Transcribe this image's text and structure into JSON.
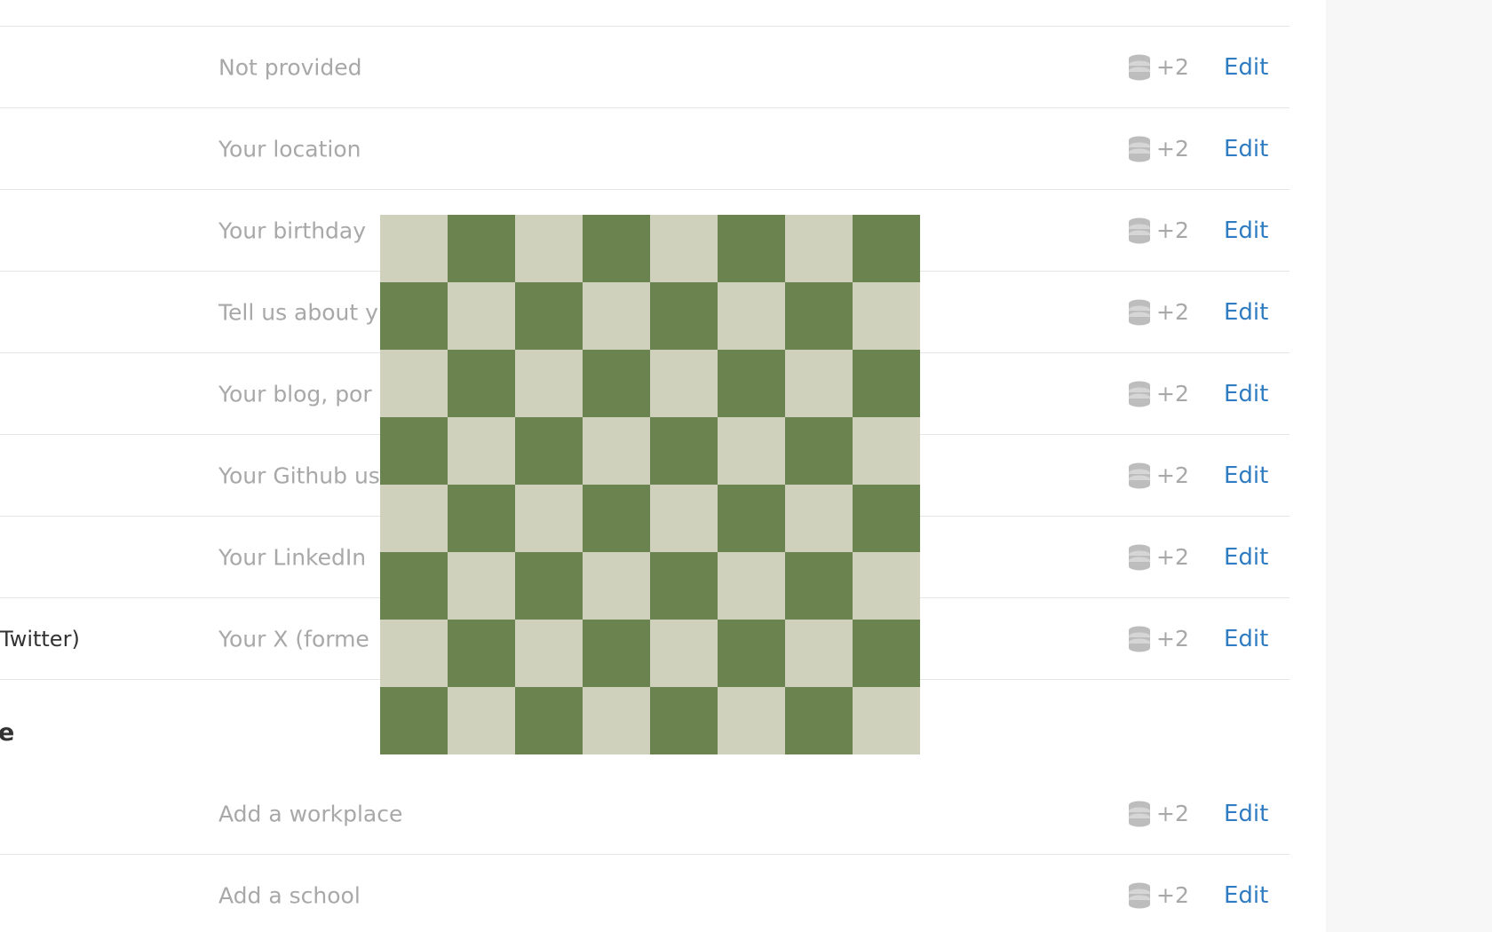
{
  "rows_top": [
    {
      "label": "",
      "value": "Not provided",
      "visibility": "+2",
      "edit": "Edit"
    },
    {
      "label": "",
      "value": "Your location",
      "visibility": "+2",
      "edit": "Edit"
    },
    {
      "label": "",
      "value": "Your birthday",
      "visibility": "+2",
      "edit": "Edit"
    },
    {
      "label": "",
      "value": "Tell us about y",
      "visibility": "+2",
      "edit": "Edit"
    },
    {
      "label": "",
      "value": "Your blog, por",
      "visibility": "+2",
      "edit": "Edit"
    },
    {
      "label": "",
      "value": "Your Github us",
      "visibility": "+2",
      "edit": "Edit"
    },
    {
      "label": "",
      "value": "Your LinkedIn",
      "visibility": "+2",
      "edit": "Edit"
    },
    {
      "label": "Twitter)",
      "value": "Your X (forme",
      "visibility": "+2",
      "edit": "Edit"
    }
  ],
  "section_heading": "e",
  "rows_bottom": [
    {
      "label": "",
      "value": "Add a workplace",
      "visibility": "+2",
      "edit": "Edit"
    },
    {
      "label": "",
      "value": "Add a school",
      "visibility": "+2",
      "edit": "Edit"
    }
  ],
  "icons": {
    "visibility": "database-icon"
  },
  "colors": {
    "accent": "#2f7cc2",
    "muted_text": "#a8a8a8",
    "checker_light": "#d0d1bc",
    "checker_dark": "#6b834e"
  }
}
